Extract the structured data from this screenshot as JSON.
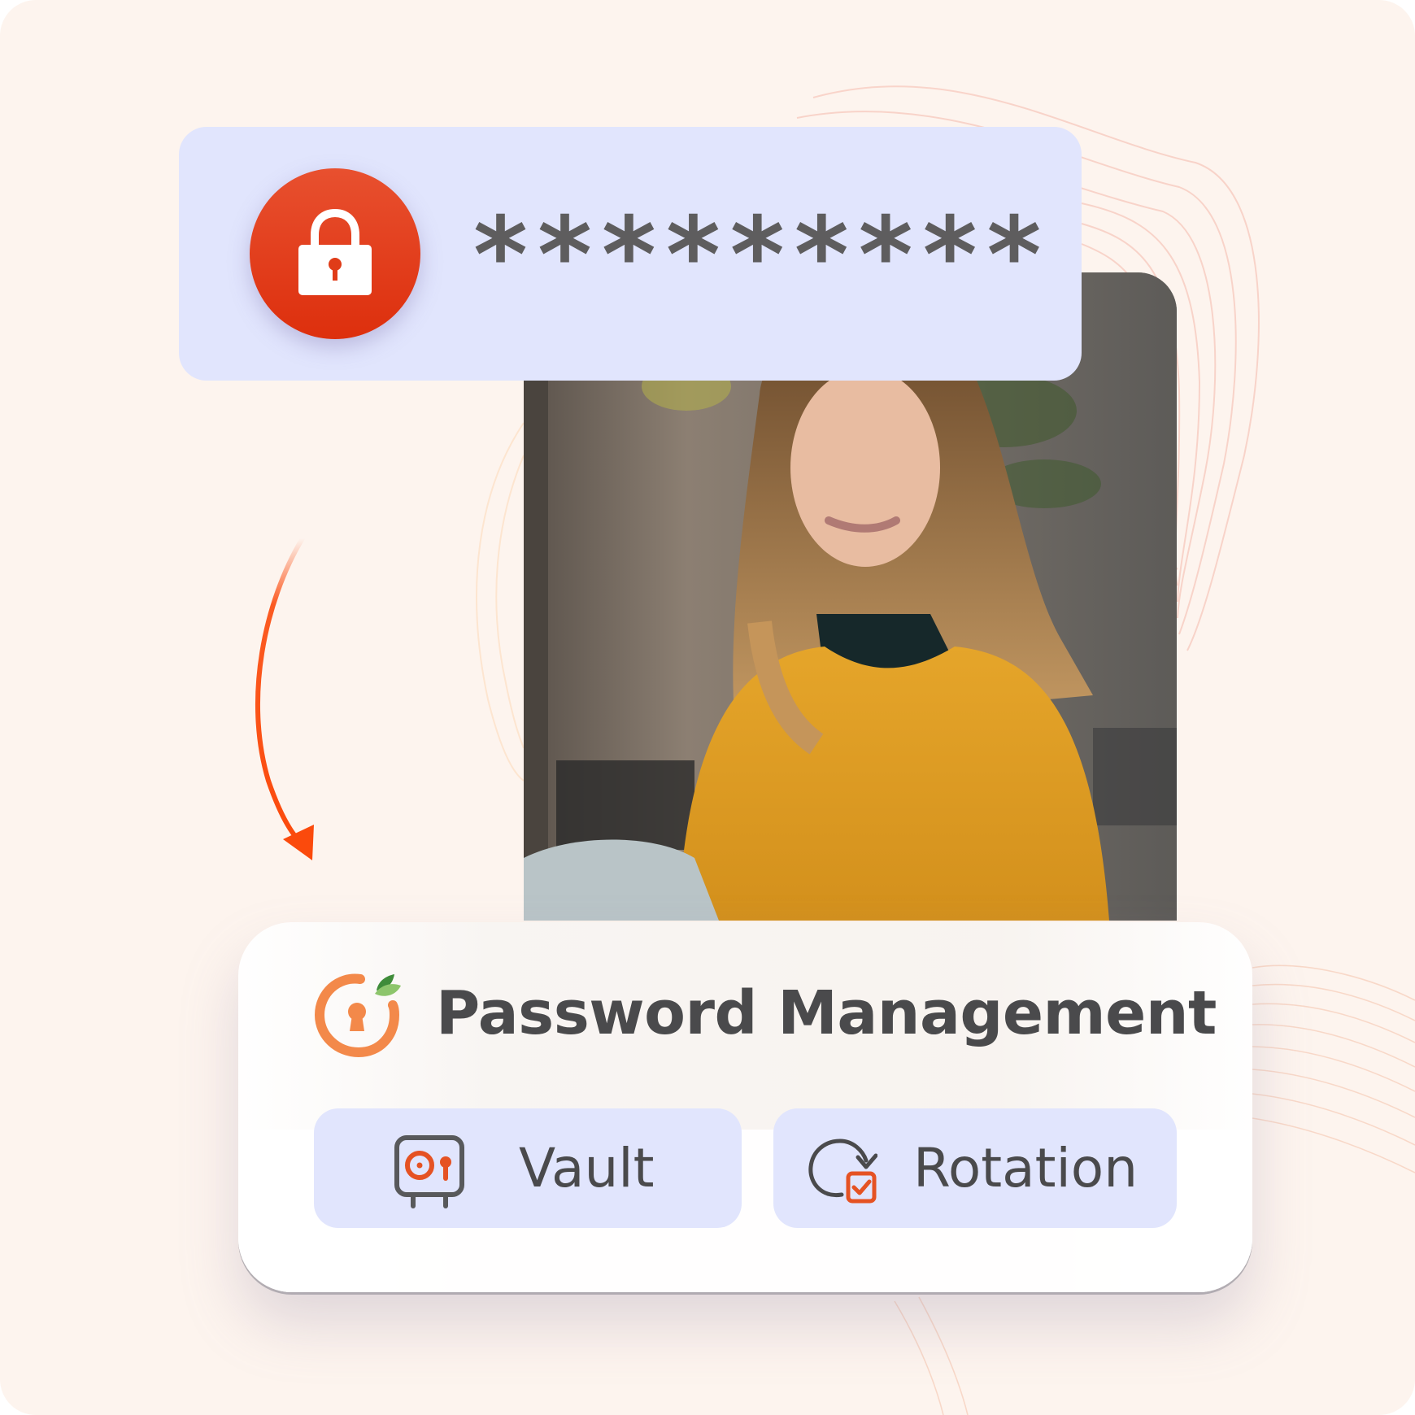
{
  "password_field": {
    "masked_value": "*********",
    "icon": "lock-icon",
    "badge_color": "#e23d17"
  },
  "photo": {
    "description": "Smiling woman in a mustard cable-knit sweater and dark turtleneck working on a laptop"
  },
  "flow_arrow": {
    "icon": "curved-arrow-down-icon",
    "color": "#fb4a0c"
  },
  "product_card": {
    "logo_icon": "keyhole-logo-icon",
    "title": "Password Management",
    "features": [
      {
        "label": "Vault",
        "icon": "safe-vault-icon"
      },
      {
        "label": "Rotation",
        "icon": "rotate-check-icon"
      }
    ]
  },
  "colors": {
    "background": "#fdf4ee",
    "card_lavender": "#e1e5fd",
    "accent_orange": "#f3894a",
    "accent_red": "#e55223",
    "text_dark": "#4a4a4c"
  }
}
